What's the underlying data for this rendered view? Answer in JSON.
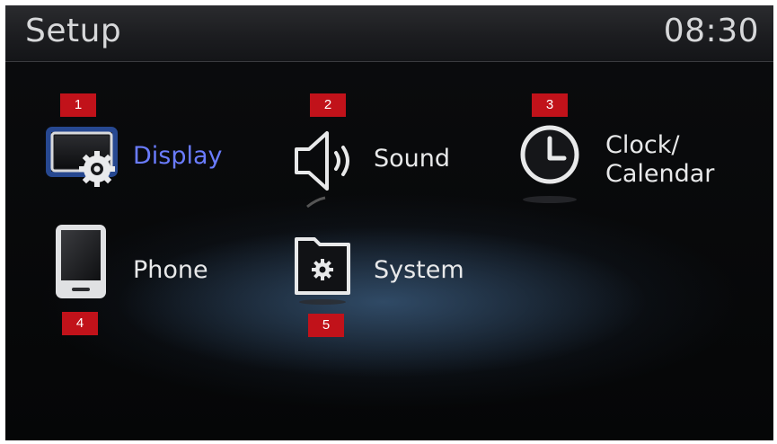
{
  "header": {
    "title": "Setup",
    "time": "08:30"
  },
  "menu": [
    {
      "label": "Display",
      "badge": "1",
      "icon": "display-settings-icon",
      "active": true
    },
    {
      "label": "Sound",
      "badge": "2",
      "icon": "speaker-icon"
    },
    {
      "label_line1": "Clock/",
      "label_line2": "Calendar",
      "badge": "3",
      "icon": "clock-icon"
    },
    {
      "label": "Phone",
      "badge": "4",
      "icon": "phone-icon"
    },
    {
      "label": "System",
      "badge": "5",
      "icon": "system-folder-icon"
    }
  ],
  "colors": {
    "active_text": "#6a7cff",
    "badge": "#c1121a",
    "text": "#e8e9ea"
  }
}
